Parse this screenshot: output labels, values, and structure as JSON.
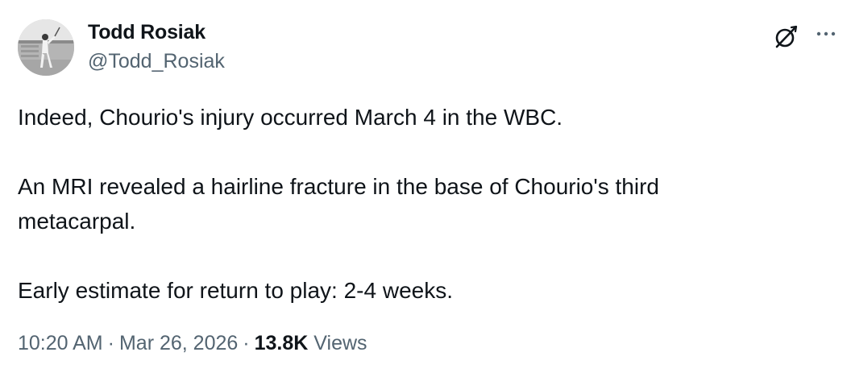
{
  "author": {
    "display_name": "Todd Rosiak",
    "handle": "@Todd_Rosiak"
  },
  "tweet": {
    "paragraphs": [
      "Indeed, Chourio's injury occurred March 4 in the WBC.",
      "An MRI revealed a hairline fracture in the base of Chourio's third metacarpal.",
      "Early estimate for return to play: 2-4 weeks."
    ]
  },
  "meta": {
    "time": "10:20 AM",
    "separator": "·",
    "date": "Mar 26, 2026",
    "views_count": "13.8K",
    "views_label": "Views"
  },
  "icons": {
    "grok": "grok-icon",
    "more": "more-icon"
  },
  "colors": {
    "text_primary": "#0f1419",
    "text_secondary": "#536471",
    "background": "#ffffff"
  }
}
